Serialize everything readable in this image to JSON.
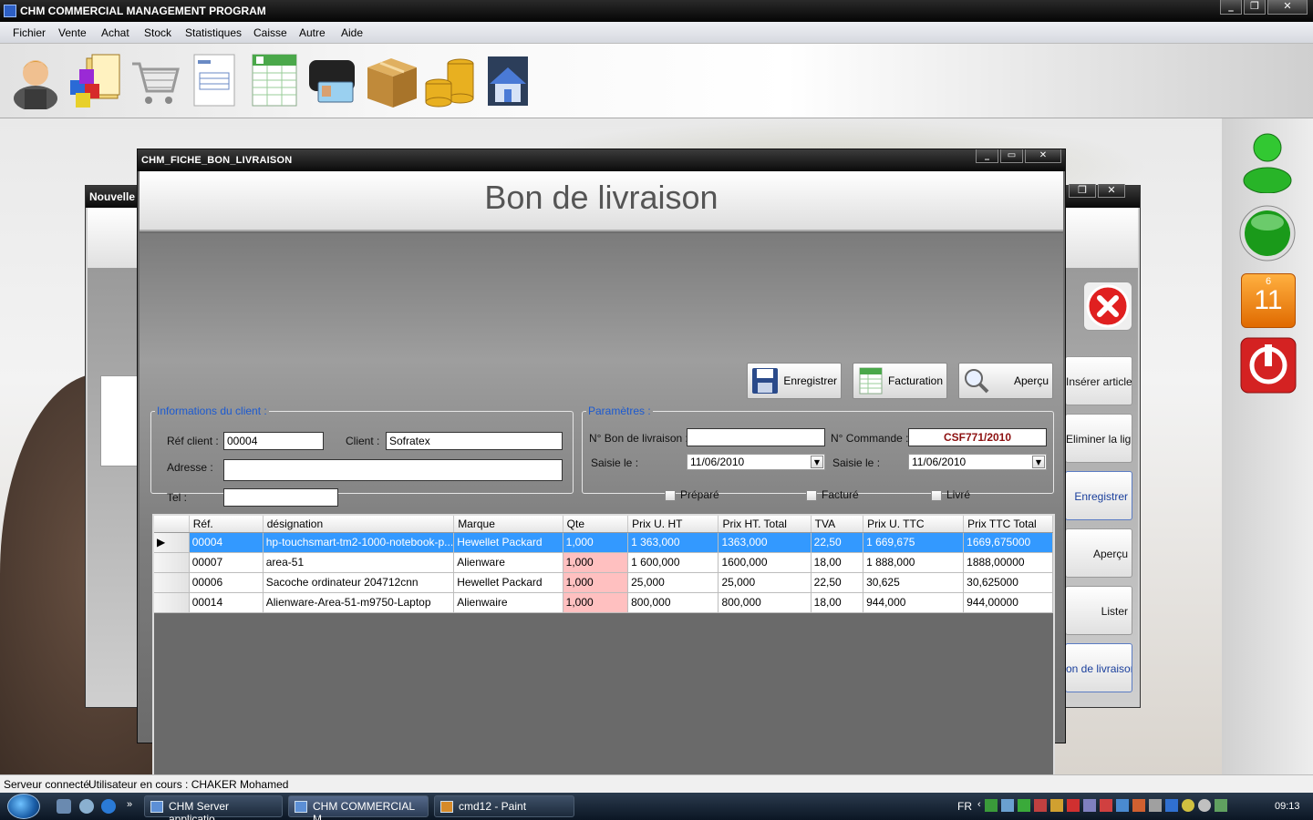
{
  "app": {
    "title": "CHM COMMERCIAL MANAGEMENT PROGRAM"
  },
  "menu": [
    "Fichier",
    "Vente",
    "Achat",
    "Stock",
    "Statistiques",
    "Caisse",
    "Autre",
    "Aide"
  ],
  "toolbar_icons": [
    "user-icon",
    "cubes-folder-icon",
    "shopping-cart-icon",
    "invoice-document-icon",
    "spreadsheet-icon",
    "wallet-cards-icon",
    "cardboard-box-icon",
    "coins-icon",
    "house-icon"
  ],
  "background_window": {
    "title": "Nouvelle",
    "side_buttons": [
      "Insérer articles",
      "Eliminer la ligne",
      "Enregistrer",
      "Aperçu",
      "Lister",
      "on de livraison"
    ]
  },
  "dialog": {
    "title": "CHM_FICHE_BON_LIVRAISON",
    "heading": "Bon de livraison",
    "buttons": {
      "save": "Enregistrer",
      "billing": "Facturation",
      "preview": "Aperçu"
    },
    "client_group": {
      "legend": "Informations du client :",
      "ref_label": "Réf client :",
      "ref_value": "00004",
      "client_label": "Client :",
      "client_value": "Sofratex",
      "address_label": "Adresse :",
      "address_value": "",
      "tel_label": "Tel :",
      "tel_value": ""
    },
    "params_group": {
      "legend": "Paramètres :",
      "delivery_no_label": "N° Bon de livraison :",
      "delivery_no_value": "",
      "order_no_label": "N° Commande :",
      "order_no_value": "CSF771/2010",
      "entered_label_1": "Saisie le :",
      "entered_value_1": "11/06/2010",
      "entered_label_2": "Saisie le :",
      "entered_value_2": "11/06/2010",
      "check_prepared": "Préparé",
      "check_invoiced": "Facturé",
      "check_delivered": "Livré"
    },
    "grid": {
      "columns": [
        "Réf.",
        "désignation",
        "Marque",
        "Qte",
        "Prix U. HT",
        "Prix HT. Total",
        "TVA",
        "Prix U. TTC",
        "Prix TTC Total"
      ],
      "rows": [
        [
          "00004",
          "hp-touchsmart-tm2-1000-notebook-p...",
          "Hewellet Packard",
          "1,000",
          "1 363,000",
          "1363,000",
          "22,50",
          "1 669,675",
          "1669,675000"
        ],
        [
          "00007",
          "area-51",
          "Alienware",
          "1,000",
          "1 600,000",
          "1600,000",
          "18,00",
          "1 888,000",
          "1888,00000"
        ],
        [
          "00006",
          "Sacoche ordinateur 204712cnn",
          "Hewellet Packard",
          "1,000",
          "25,000",
          "25,000",
          "22,50",
          "30,625",
          "30,625000"
        ],
        [
          "00014",
          "Alienware-Area-51-m9750-Laptop",
          "Alienwaire",
          "1,000",
          "800,000",
          "800,000",
          "18,00",
          "944,000",
          "944,00000"
        ]
      ]
    }
  },
  "right_panel": {
    "calendar_month": "6",
    "calendar_day": "11"
  },
  "status": {
    "server": "Serveur connecté",
    "user": "Utilisateur en cours : CHAKER Mohamed"
  },
  "taskbar": {
    "tasks": [
      "CHM Server applicatio...",
      "CHM COMMERCIAL M...",
      "cmd12 - Paint"
    ],
    "lang": "FR",
    "clock": "09:13"
  },
  "colors": {
    "selection": "#3399ff",
    "legend": "#1c5ad0",
    "order_no": "#8c1010",
    "qty_highlight": "#ffc0c0"
  }
}
